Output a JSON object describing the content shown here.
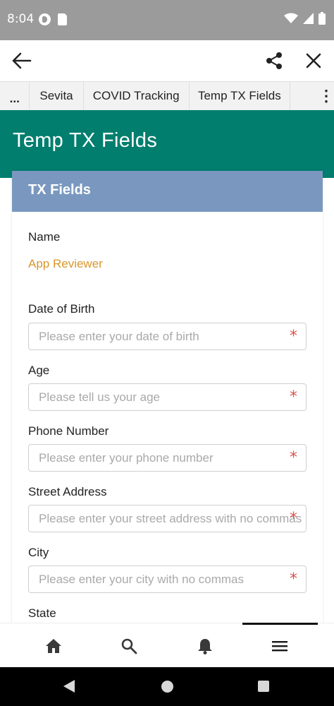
{
  "status_bar": {
    "time": "8:04",
    "icons": [
      "app-notification-icon",
      "sd-card-icon",
      "wifi-icon",
      "signal-icon",
      "battery-icon"
    ]
  },
  "header": {
    "icons": [
      "back-arrow-icon",
      "share-icon",
      "close-icon"
    ]
  },
  "tabs": [
    {
      "label": "..."
    },
    {
      "label": "Sevita"
    },
    {
      "label": "COVID Tracking"
    },
    {
      "label": "Temp TX Fields",
      "active": true
    },
    {
      "label": "⋮"
    }
  ],
  "page": {
    "title": "Temp TX Fields"
  },
  "card": {
    "title": "TX Fields",
    "name_label": "Name",
    "name_value": "App Reviewer",
    "fields": [
      {
        "label": "Date of Birth",
        "placeholder": "Please enter your date of birth",
        "required": true
      },
      {
        "label": "Age",
        "placeholder": "Please tell us your age",
        "required": true
      },
      {
        "label": "Phone Number",
        "placeholder": "Please enter your phone number",
        "required": true
      },
      {
        "label": "Street Address",
        "placeholder": "Please enter your street address with no commas",
        "required": true
      },
      {
        "label": "City",
        "placeholder": "Please enter your city with no commas",
        "required": true
      },
      {
        "label": "State"
      }
    ],
    "required_marker": "*"
  },
  "bottom_nav": {
    "items": [
      "home-icon",
      "search-icon",
      "bell-icon",
      "menu-icon"
    ],
    "active": "menu-icon"
  },
  "colors": {
    "status_bar": "#9b9b9b",
    "banner": "#017e6e",
    "card_header": "#7a98bf",
    "name_value": "#d9962b",
    "required": "#d9534f",
    "placeholder": "#a9a9a9"
  }
}
